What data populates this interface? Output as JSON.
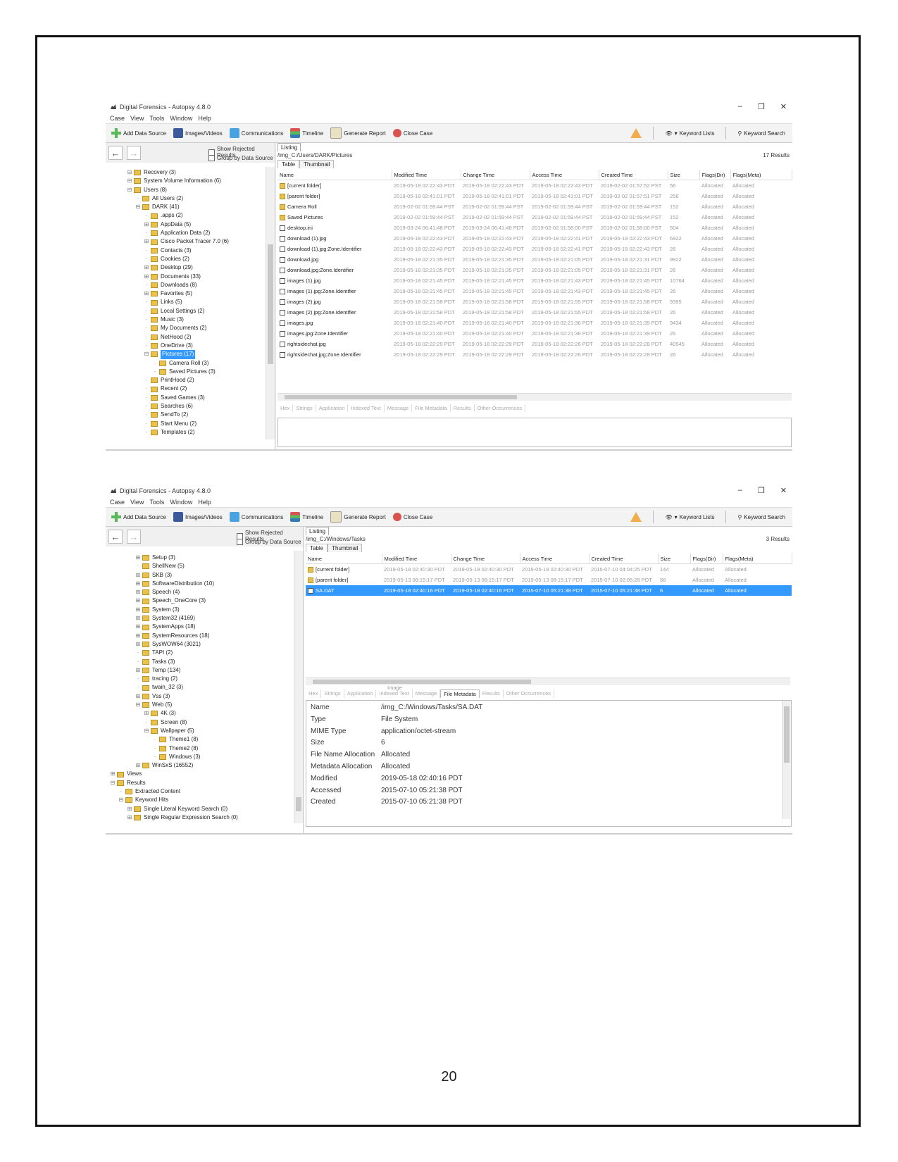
{
  "page": {
    "number": "20"
  },
  "app": {
    "title": "Digital Forensics - Autopsy 4.8.0",
    "menu": [
      "Case",
      "View",
      "Tools",
      "Window",
      "Help"
    ],
    "toolbar": {
      "add_data_source": "Add Data Source",
      "images_videos": "Images/Videos",
      "communications": "Communications",
      "timeline": "Timeline",
      "generate_report": "Generate Report",
      "close_case": "Close Case",
      "keyword_lists": "Keyword Lists",
      "keyword_search": "Keyword Search"
    },
    "show_rejected": "Show Rejected Results",
    "group_by_source": "Group by Data Source",
    "listing_label": "Listing",
    "tab_table": "Table",
    "tab_thumbnail": "Thumbnail",
    "columns": [
      "Name",
      "Modified Time",
      "Change Time",
      "Access Time",
      "Created Time",
      "Size",
      "Flags(Dir)",
      "Flags(Meta)"
    ],
    "content_tabs": [
      "Hex",
      "Strings",
      "Application",
      "Indexed Text",
      "Message",
      "File Metadata",
      "Results",
      "Other Occurrences"
    ]
  },
  "shot1": {
    "path": "/img_C:/Users/DARK/Pictures",
    "results": "17 Results",
    "tree": [
      {
        "label": "Recovery (3)",
        "indent": 2,
        "exp": "-"
      },
      {
        "label": "System Volume Information (6)",
        "indent": 2,
        "exp": "-"
      },
      {
        "label": "Users (8)",
        "indent": 2,
        "exp": "-"
      },
      {
        "label": "All Users (2)",
        "indent": 3,
        "exp": ""
      },
      {
        "label": "DARK (41)",
        "indent": 3,
        "exp": "-"
      },
      {
        "label": ".apps (2)",
        "indent": 4,
        "exp": ""
      },
      {
        "label": "AppData (5)",
        "indent": 4,
        "exp": "+"
      },
      {
        "label": "Application Data (2)",
        "indent": 4,
        "exp": ""
      },
      {
        "label": "Cisco Packet Tracer 7.0 (6)",
        "indent": 4,
        "exp": "+"
      },
      {
        "label": "Contacts (3)",
        "indent": 4,
        "exp": ""
      },
      {
        "label": "Cookies (2)",
        "indent": 4,
        "exp": ""
      },
      {
        "label": "Desktop (29)",
        "indent": 4,
        "exp": "+"
      },
      {
        "label": "Documents (33)",
        "indent": 4,
        "exp": "+"
      },
      {
        "label": "Downloads (8)",
        "indent": 4,
        "exp": ""
      },
      {
        "label": "Favorites (5)",
        "indent": 4,
        "exp": "+"
      },
      {
        "label": "Links (5)",
        "indent": 4,
        "exp": ""
      },
      {
        "label": "Local Settings (2)",
        "indent": 4,
        "exp": ""
      },
      {
        "label": "Music (3)",
        "indent": 4,
        "exp": ""
      },
      {
        "label": "My Documents (2)",
        "indent": 4,
        "exp": ""
      },
      {
        "label": "NetHood (2)",
        "indent": 4,
        "exp": ""
      },
      {
        "label": "OneDrive (3)",
        "indent": 4,
        "exp": ""
      },
      {
        "label": "Pictures (17)",
        "indent": 4,
        "exp": "-",
        "sel": true
      },
      {
        "label": "Camera Roll (3)",
        "indent": 5,
        "exp": ""
      },
      {
        "label": "Saved Pictures (3)",
        "indent": 5,
        "exp": ""
      },
      {
        "label": "PrintHood (2)",
        "indent": 4,
        "exp": ""
      },
      {
        "label": "Recent (2)",
        "indent": 4,
        "exp": ""
      },
      {
        "label": "Saved Games (3)",
        "indent": 4,
        "exp": ""
      },
      {
        "label": "Searches (6)",
        "indent": 4,
        "exp": ""
      },
      {
        "label": "SendTo (2)",
        "indent": 4,
        "exp": ""
      },
      {
        "label": "Start Menu (2)",
        "indent": 4,
        "exp": ""
      },
      {
        "label": "Templates (2)",
        "indent": 4,
        "exp": ""
      }
    ],
    "rows": [
      {
        "icon": "folder",
        "name": "[current folder]",
        "mod": "2019-05-18 02:22:43 PDT",
        "chg": "2019-05-18 02:22:43 PDT",
        "acc": "2019-05-18 02:22:43 PDT",
        "cre": "2019-02-02 01:57:52 PST",
        "size": "56",
        "fd": "Allocated",
        "fm": "Allocated"
      },
      {
        "icon": "folder",
        "name": "[parent folder]",
        "mod": "2019-05-18 02:41:01 PDT",
        "chg": "2019-05-18 02:41:01 PDT",
        "acc": "2019-05-18 02:41:01 PDT",
        "cre": "2019-02-02 01:57:51 PST",
        "size": "256",
        "fd": "Allocated",
        "fm": "Allocated"
      },
      {
        "icon": "folder",
        "name": "Camera Roll",
        "mod": "2019-02-02 01:59:44 PST",
        "chg": "2019-02-02 01:59:44 PST",
        "acc": "2019-02-02 01:59:44 PST",
        "cre": "2019-02-02 01:59:44 PST",
        "size": "152",
        "fd": "Allocated",
        "fm": "Allocated"
      },
      {
        "icon": "folder",
        "name": "Saved Pictures",
        "mod": "2019-02-02 01:59:44 PST",
        "chg": "2019-02-02 01:59:44 PST",
        "acc": "2019-02-02 01:59:44 PST",
        "cre": "2019-02-02 01:59:44 PST",
        "size": "152",
        "fd": "Allocated",
        "fm": "Allocated"
      },
      {
        "icon": "file",
        "name": "desktop.ini",
        "mod": "2019-03-24 06:41:48 PDT",
        "chg": "2019-03-24 06:41:48 PDT",
        "acc": "2019-02-02 01:58:00 PST",
        "cre": "2019-02-02 01:58:00 PST",
        "size": "504",
        "fd": "Allocated",
        "fm": "Allocated"
      },
      {
        "icon": "file",
        "name": "download (1).jpg",
        "mod": "2019-05-18 02:22:43 PDT",
        "chg": "2019-05-18 02:22:43 PDT",
        "acc": "2019-05-18 02:22:41 PDT",
        "cre": "2019-05-18 02:22:43 PDT",
        "size": "6922",
        "fd": "Allocated",
        "fm": "Allocated"
      },
      {
        "icon": "file",
        "name": "download (1).jpg:Zone.Identifier",
        "mod": "2019-05-18 02:22:43 PDT",
        "chg": "2019-05-18 02:22:43 PDT",
        "acc": "2019-05-18 02:22:41 PDT",
        "cre": "2019-05-18 02:22:43 PDT",
        "size": "26",
        "fd": "Allocated",
        "fm": "Allocated"
      },
      {
        "icon": "file",
        "name": "download.jpg",
        "mod": "2019-05-18 02:21:35 PDT",
        "chg": "2019-05-18 02:21:35 PDT",
        "acc": "2019-05-18 02:21:05 PDT",
        "cre": "2019-05-18 02:21:31 PDT",
        "size": "9922",
        "fd": "Allocated",
        "fm": "Allocated"
      },
      {
        "icon": "file",
        "name": "download.jpg:Zone.Identifier",
        "mod": "2019-05-18 02:21:35 PDT",
        "chg": "2019-05-18 02:21:35 PDT",
        "acc": "2019-05-18 02:21:05 PDT",
        "cre": "2019-05-18 02:21:31 PDT",
        "size": "26",
        "fd": "Allocated",
        "fm": "Allocated"
      },
      {
        "icon": "file",
        "name": "images (1).jpg",
        "mod": "2019-05-18 02:21:45 PDT",
        "chg": "2019-05-18 02:21:45 PDT",
        "acc": "2019-05-18 02:21:43 PDT",
        "cre": "2019-05-18 02:21:45 PDT",
        "size": "10764",
        "fd": "Allocated",
        "fm": "Allocated"
      },
      {
        "icon": "file",
        "name": "images (1).jpg:Zone.Identifier",
        "mod": "2019-05-18 02:21:45 PDT",
        "chg": "2019-05-18 02:21:45 PDT",
        "acc": "2019-05-18 02:21:43 PDT",
        "cre": "2019-05-18 02:21:45 PDT",
        "size": "26",
        "fd": "Allocated",
        "fm": "Allocated"
      },
      {
        "icon": "file",
        "name": "images (2).jpg",
        "mod": "2019-05-18 02:21:58 PDT",
        "chg": "2019-05-18 02:21:58 PDT",
        "acc": "2019-05-18 02:21:55 PDT",
        "cre": "2019-05-18 02:21:58 PDT",
        "size": "9395",
        "fd": "Allocated",
        "fm": "Allocated"
      },
      {
        "icon": "file",
        "name": "images (2).jpg:Zone.Identifier",
        "mod": "2019-05-18 02:21:58 PDT",
        "chg": "2019-05-18 02:21:58 PDT",
        "acc": "2019-05-18 02:21:55 PDT",
        "cre": "2019-05-18 02:21:58 PDT",
        "size": "26",
        "fd": "Allocated",
        "fm": "Allocated"
      },
      {
        "icon": "file",
        "name": "images.jpg",
        "mod": "2019-05-18 02:21:40 PDT",
        "chg": "2019-05-18 02:21:40 PDT",
        "acc": "2019-05-18 02:21:36 PDT",
        "cre": "2019-05-18 02:21:39 PDT",
        "size": "9434",
        "fd": "Allocated",
        "fm": "Allocated"
      },
      {
        "icon": "file",
        "name": "images.jpg:Zone.Identifier",
        "mod": "2019-05-18 02:21:40 PDT",
        "chg": "2019-05-18 02:21:40 PDT",
        "acc": "2019-05-18 02:21:36 PDT",
        "cre": "2019-05-18 02:21:39 PDT",
        "size": "26",
        "fd": "Allocated",
        "fm": "Allocated"
      },
      {
        "icon": "file",
        "name": "rightsidechat.jpg",
        "mod": "2019-05-18 02:22:29 PDT",
        "chg": "2019-05-18 02:22:29 PDT",
        "acc": "2019-05-18 02:22:26 PDT",
        "cre": "2019-05-18 02:22:28 PDT",
        "size": "40545",
        "fd": "Allocated",
        "fm": "Allocated"
      },
      {
        "icon": "file",
        "name": "rightsidechat.jpg:Zone.Identifier",
        "mod": "2019-05-18 02:22:29 PDT",
        "chg": "2019-05-18 02:22:29 PDT",
        "acc": "2019-05-18 02:22:26 PDT",
        "cre": "2019-05-18 02:22:28 PDT",
        "size": "26",
        "fd": "Allocated",
        "fm": "Allocated"
      }
    ]
  },
  "shot2": {
    "path": "/img_C:/Windows/Tasks",
    "results": "3 Results",
    "tree": [
      {
        "label": "Setup (3)",
        "indent": 3,
        "exp": "+"
      },
      {
        "label": "ShellNew (5)",
        "indent": 3,
        "exp": ""
      },
      {
        "label": "SKB (3)",
        "indent": 3,
        "exp": "+"
      },
      {
        "label": "SoftwareDistribution (10)",
        "indent": 3,
        "exp": "+"
      },
      {
        "label": "Speech (4)",
        "indent": 3,
        "exp": "+"
      },
      {
        "label": "Speech_OneCore (3)",
        "indent": 3,
        "exp": "+"
      },
      {
        "label": "System (3)",
        "indent": 3,
        "exp": "+"
      },
      {
        "label": "System32 (4169)",
        "indent": 3,
        "exp": "+"
      },
      {
        "label": "SystemApps (18)",
        "indent": 3,
        "exp": "+"
      },
      {
        "label": "SystemResources (18)",
        "indent": 3,
        "exp": "+"
      },
      {
        "label": "SysWOW64 (3021)",
        "indent": 3,
        "exp": "+"
      },
      {
        "label": "TAPI (2)",
        "indent": 3,
        "exp": ""
      },
      {
        "label": "Tasks (3)",
        "indent": 3,
        "exp": ""
      },
      {
        "label": "Temp (134)",
        "indent": 3,
        "exp": "+"
      },
      {
        "label": "tracing (2)",
        "indent": 3,
        "exp": ""
      },
      {
        "label": "twain_32 (3)",
        "indent": 3,
        "exp": ""
      },
      {
        "label": "Vss (3)",
        "indent": 3,
        "exp": "+"
      },
      {
        "label": "Web (5)",
        "indent": 3,
        "exp": "-"
      },
      {
        "label": "4K (3)",
        "indent": 4,
        "exp": "+"
      },
      {
        "label": "Screen (8)",
        "indent": 4,
        "exp": ""
      },
      {
        "label": "Wallpaper (5)",
        "indent": 4,
        "exp": "-"
      },
      {
        "label": "Theme1 (8)",
        "indent": 5,
        "exp": ""
      },
      {
        "label": "Theme2 (8)",
        "indent": 5,
        "exp": ""
      },
      {
        "label": "Windows (3)",
        "indent": 5,
        "exp": ""
      },
      {
        "label": "WinSxS (16552)",
        "indent": 3,
        "exp": "+"
      },
      {
        "label": "Views",
        "indent": 0,
        "exp": "+"
      },
      {
        "label": "Results",
        "indent": 0,
        "exp": "-"
      },
      {
        "label": "Extracted Content",
        "indent": 1,
        "exp": ""
      },
      {
        "label": "Keyword Hits",
        "indent": 1,
        "exp": "-"
      },
      {
        "label": "Single Literal Keyword Search (0)",
        "indent": 2,
        "exp": "+"
      },
      {
        "label": "Single Regular Expression Search (0)",
        "indent": 2,
        "exp": "+"
      }
    ],
    "rows": [
      {
        "icon": "folder",
        "name": "[current folder]",
        "mod": "2019-05-18 02:40:30 PDT",
        "chg": "2019-05-18 02:40:30 PDT",
        "acc": "2019-05-18 02:40:30 PDT",
        "cre": "2015-07-10 04:04:25 PDT",
        "size": "144",
        "fd": "Allocated",
        "fm": "Allocated"
      },
      {
        "icon": "folder",
        "name": "[parent folder]",
        "mod": "2019-05-13 08:15:17 PDT",
        "chg": "2019-05-13 08:15:17 PDT",
        "acc": "2019-05-13 08:15:17 PDT",
        "cre": "2015-07-10 02:05:28 PDT",
        "size": "56",
        "fd": "Allocated",
        "fm": "Allocated"
      },
      {
        "icon": "file",
        "name": "SA.DAT",
        "mod": "2019-05-18 02:40:16 PDT",
        "chg": "2019-05-18 02:40:16 PDT",
        "acc": "2015-07-10 05:21:38 PDT",
        "cre": "2015-07-10 05:21:38 PDT",
        "size": "6",
        "fd": "Allocated",
        "fm": "Allocated",
        "sel": true
      }
    ],
    "image_tab": "Image",
    "metadata": [
      {
        "k": "Name",
        "v": "/img_C:/Windows/Tasks/SA.DAT"
      },
      {
        "k": "Type",
        "v": "File System"
      },
      {
        "k": "MIME Type",
        "v": "application/octet-stream"
      },
      {
        "k": "Size",
        "v": "6"
      },
      {
        "k": "File Name Allocation",
        "v": "Allocated"
      },
      {
        "k": "Metadata Allocation",
        "v": "Allocated"
      },
      {
        "k": "Modified",
        "v": "2019-05-18 02:40:16 PDT"
      },
      {
        "k": "Accessed",
        "v": "2015-07-10 05:21:38 PDT"
      },
      {
        "k": "Created",
        "v": "2015-07-10 05:21:38 PDT"
      }
    ]
  }
}
